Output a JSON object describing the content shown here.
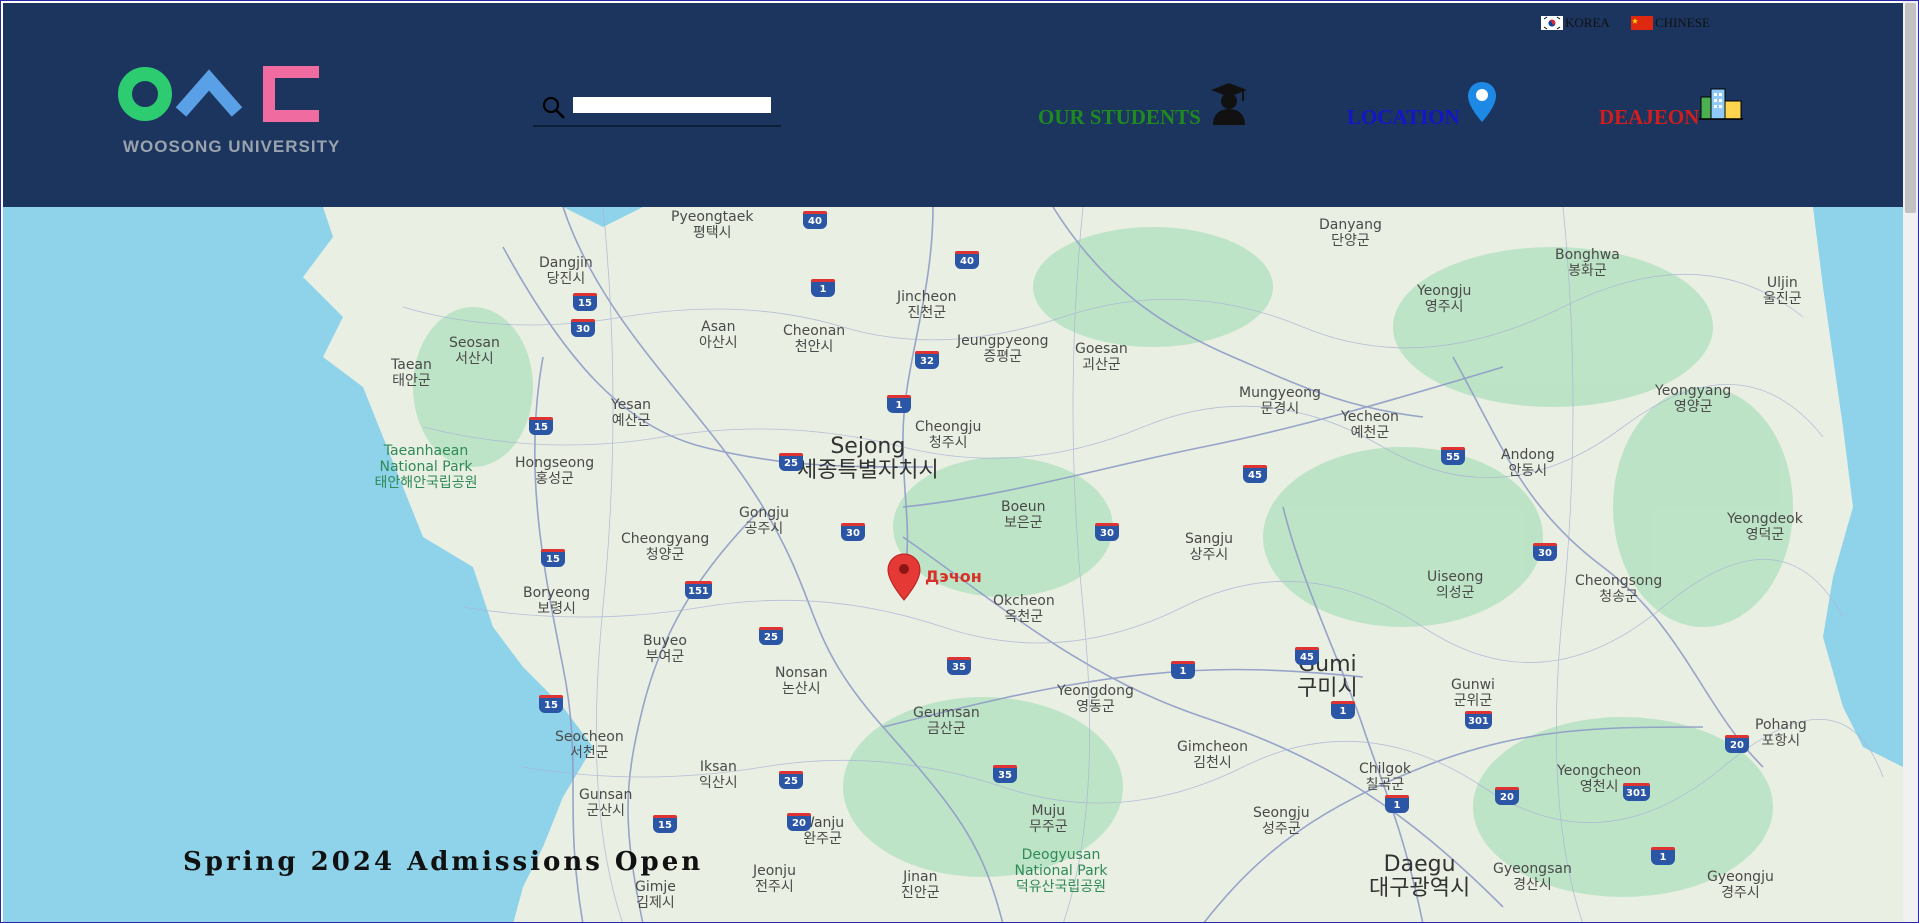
{
  "languages": [
    {
      "label": "KOREA",
      "flag": "korea-flag"
    },
    {
      "label": "CHINESE",
      "flag": "china-flag"
    }
  ],
  "logo": {
    "text": "WOOSONG UNIVERSITY",
    "colors": {
      "circle": "#2ecc71",
      "chevron": "#5aa0e6",
      "bracket": "#f06ba0"
    }
  },
  "search": {
    "value": "",
    "placeholder": ""
  },
  "nav": [
    {
      "label": "OUR STUDENTS",
      "color": "#1f8a1f",
      "icon": "graduate-icon"
    },
    {
      "label": "LOCATION",
      "color": "#1414c8",
      "icon": "map-pin-icon"
    },
    {
      "label": "DEAJEON",
      "color": "#d11d1d",
      "icon": "city-icon"
    }
  ],
  "map": {
    "marker_label": "Дэчон",
    "places": [
      {
        "name": "Pyeongtaek",
        "local": "평택시"
      },
      {
        "name": "Dangjin",
        "local": "당진시"
      },
      {
        "name": "Asan",
        "local": "아산시"
      },
      {
        "name": "Cheonan",
        "local": "천안시"
      },
      {
        "name": "Jincheon",
        "local": "진천군"
      },
      {
        "name": "Seosan",
        "local": "서산시"
      },
      {
        "name": "Taean",
        "local": "태안군"
      },
      {
        "name": "Yesan",
        "local": "예산군"
      },
      {
        "name": "Jeungpyeong",
        "local": "증평군"
      },
      {
        "name": "Goesan",
        "local": "괴산군"
      },
      {
        "name": "Danyang",
        "local": "단양군"
      },
      {
        "name": "Yeongju",
        "local": "영주시"
      },
      {
        "name": "Bonghwa",
        "local": "봉화군"
      },
      {
        "name": "Uljin",
        "local": "울진군"
      },
      {
        "name": "Sejong",
        "local": "세종특별자치시"
      },
      {
        "name": "Cheongju",
        "local": "청주시"
      },
      {
        "name": "Mungyeong",
        "local": "문경시"
      },
      {
        "name": "Yecheon",
        "local": "예천군"
      },
      {
        "name": "Yeongyang",
        "local": "영양군"
      },
      {
        "name": "Taeanhaean National Park",
        "local": "태안해안국립공원"
      },
      {
        "name": "Hongseong",
        "local": "홍성군"
      },
      {
        "name": "Gongju",
        "local": "공주시"
      },
      {
        "name": "Boeun",
        "local": "보은군"
      },
      {
        "name": "Sangju",
        "local": "상주시"
      },
      {
        "name": "Andong",
        "local": "안동시"
      },
      {
        "name": "Yeongdeok",
        "local": "영덕군"
      },
      {
        "name": "Cheongyang",
        "local": "청양군"
      },
      {
        "name": "Boryeong",
        "local": "보령시"
      },
      {
        "name": "Okcheon",
        "local": "옥천군"
      },
      {
        "name": "Uiseong",
        "local": "의성군"
      },
      {
        "name": "Cheongsong",
        "local": "청송군"
      },
      {
        "name": "Buyeo",
        "local": "부여군"
      },
      {
        "name": "Nonsan",
        "local": "논산시"
      },
      {
        "name": "Yeongdong",
        "local": "영동군"
      },
      {
        "name": "Gumi",
        "local": "구미시"
      },
      {
        "name": "Gunwi",
        "local": "군위군"
      },
      {
        "name": "Pohang",
        "local": "포항시"
      },
      {
        "name": "Geumsan",
        "local": "금산군"
      },
      {
        "name": "Seocheon",
        "local": "서천군"
      },
      {
        "name": "Iksan",
        "local": "익산시"
      },
      {
        "name": "Gimcheon",
        "local": "김천시"
      },
      {
        "name": "Chilgok",
        "local": "칠곡군"
      },
      {
        "name": "Yeongcheon",
        "local": "영천시"
      },
      {
        "name": "Gunsan",
        "local": "군산시"
      },
      {
        "name": "Wanju",
        "local": "완주군"
      },
      {
        "name": "Muju",
        "local": "무주군"
      },
      {
        "name": "Seongju",
        "local": "성주군"
      },
      {
        "name": "Deogyusan National Park",
        "local": "덕유산국립공원"
      },
      {
        "name": "Daegu",
        "local": "대구광역시"
      },
      {
        "name": "Gyeongsan",
        "local": "경산시"
      },
      {
        "name": "Gyeongju",
        "local": "경주시"
      },
      {
        "name": "Jeonju",
        "local": "전주시"
      },
      {
        "name": "Jinan",
        "local": "진안군"
      },
      {
        "name": "Gimje",
        "local": "김제시"
      }
    ],
    "shields": [
      "40",
      "40",
      "1",
      "15",
      "30",
      "32",
      "1",
      "15",
      "25",
      "30",
      "30",
      "45",
      "55",
      "30",
      "15",
      "151",
      "25",
      "35",
      "1",
      "45",
      "1",
      "301",
      "20",
      "15",
      "25",
      "35",
      "20",
      "15",
      "1",
      "20",
      "301",
      "1"
    ]
  },
  "banner": {
    "text": "Spring 2024 Admissions Open"
  }
}
